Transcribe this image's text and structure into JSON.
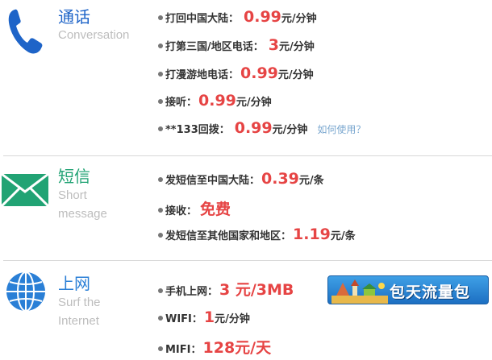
{
  "colors": {
    "call_title": "#1e64c8",
    "sms_title": "#21a374",
    "net_title": "#2a7fd6",
    "price": "#e64444",
    "sub": "#bdbdbd"
  },
  "call": {
    "icon": "phone-handset-icon",
    "title": "通话",
    "subtitle": "Conversation",
    "rows": [
      {
        "label": "打回中国大陆：",
        "price": "0.99",
        "unit": "元/分钟"
      },
      {
        "label": "打第三国/地区电话：",
        "price": "3",
        "unit": "元/分钟"
      },
      {
        "label": "打漫游地电话：",
        "price": "0.99",
        "unit": "元/分钟"
      },
      {
        "label": "接听：",
        "price": "0.99",
        "unit": "元/分钟"
      },
      {
        "label": "**133回拨：",
        "price": "0.99",
        "unit": "元/分钟",
        "link": "如何使用？"
      }
    ]
  },
  "sms": {
    "icon": "envelope-icon",
    "title": "短信",
    "subtitle_line1": "Short",
    "subtitle_line2": "message",
    "rows": [
      {
        "label": "发短信至中国大陆：",
        "price": "0.39",
        "unit": "元/条"
      },
      {
        "label": "接收：",
        "price": "免费",
        "unit": ""
      },
      {
        "label": "发短信至其他国家和地区：",
        "price": "1.19",
        "unit": "元/条"
      }
    ]
  },
  "net": {
    "icon": "globe-icon",
    "title": "上网",
    "subtitle_line1": "Surf the",
    "subtitle_line2": "Internet",
    "rows": [
      {
        "label": "手机上网：",
        "price": "3 元/3MB",
        "unit": ""
      },
      {
        "label": "WIFI：",
        "price": "1",
        "unit": "元/分钟"
      },
      {
        "label": "MIFI：",
        "price": "128元/天",
        "unit": ""
      }
    ],
    "banner": {
      "text": "包天流量包",
      "icon": "travel-landmarks-icon"
    }
  }
}
